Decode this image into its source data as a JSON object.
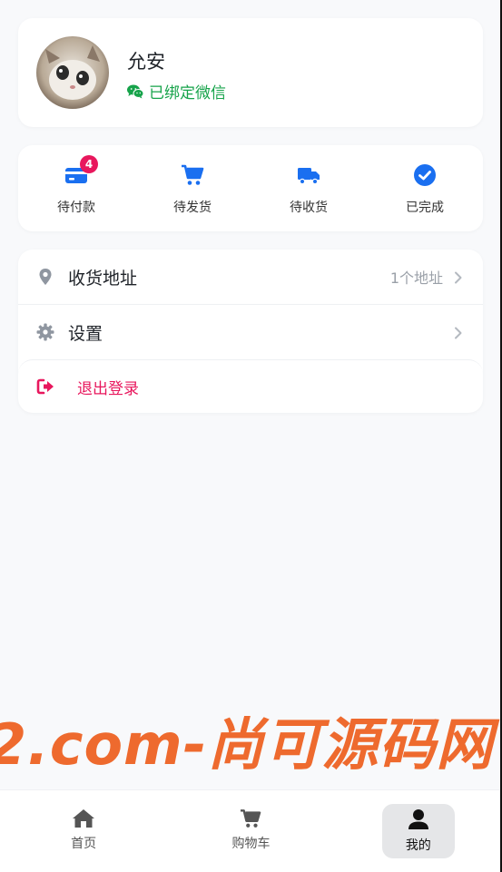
{
  "profile": {
    "username": "允安",
    "wechat_status": "已绑定微信"
  },
  "orders": [
    {
      "label": "待付款",
      "icon": "wallet-icon",
      "badge": "4"
    },
    {
      "label": "待发货",
      "icon": "cart-icon"
    },
    {
      "label": "待收货",
      "icon": "truck-icon"
    },
    {
      "label": "已完成",
      "icon": "check-circle-icon"
    }
  ],
  "menu": {
    "address": {
      "label": "收货地址",
      "value": "1个地址",
      "icon": "location-pin-icon"
    },
    "settings": {
      "label": "设置",
      "icon": "gear-icon"
    },
    "logout": {
      "label": "退出登录",
      "icon": "logout-icon"
    }
  },
  "watermark": "2.com-尚可源码网",
  "bottom_nav": [
    {
      "label": "首页",
      "icon": "home-icon"
    },
    {
      "label": "购物车",
      "icon": "cart-icon"
    },
    {
      "label": "我的",
      "icon": "user-icon",
      "active": true
    }
  ],
  "colors": {
    "primary": "#1a6ff0",
    "wechat_green": "#16a34a",
    "logout_pink": "#e8175d",
    "muted": "#9aa0a8",
    "watermark": "#ee6a2e"
  }
}
